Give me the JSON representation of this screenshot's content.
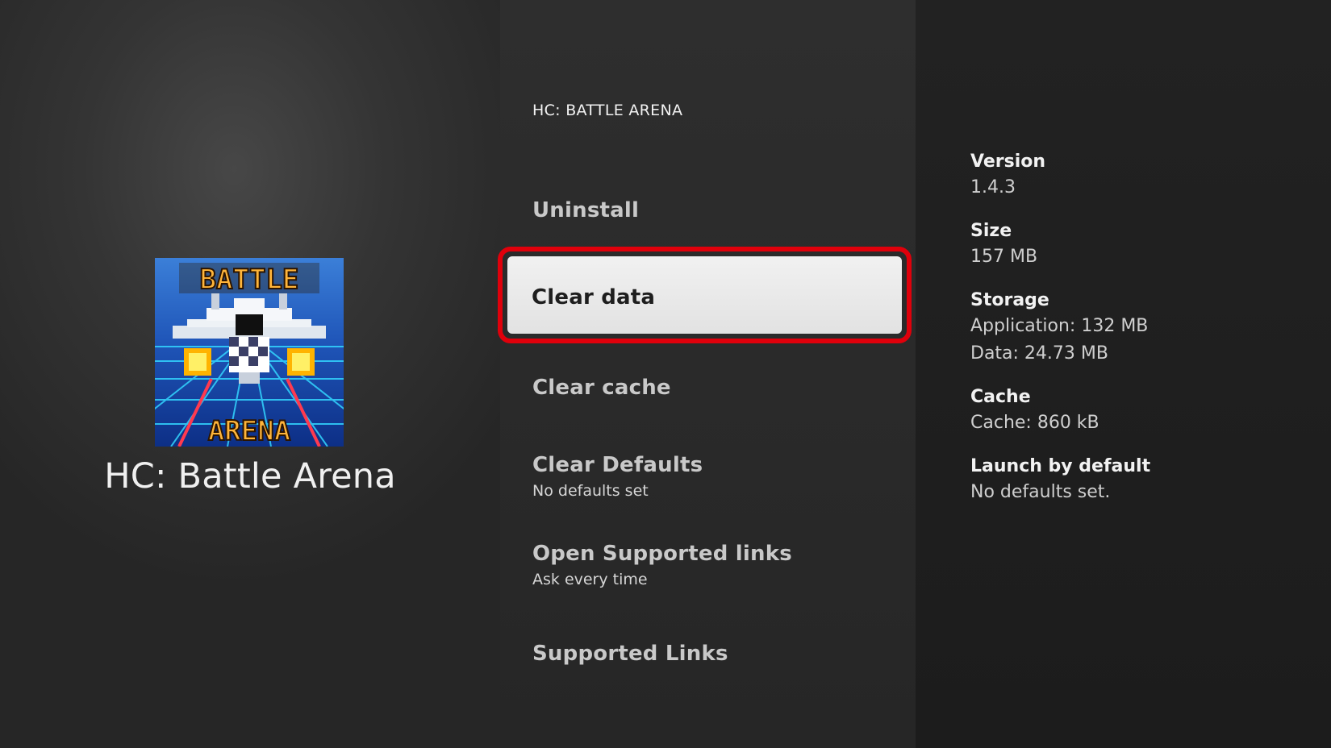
{
  "app": {
    "name": "HC: Battle Arena",
    "icon_text_top": "BATTLE",
    "icon_text_bottom": "ARENA"
  },
  "menu": {
    "header": "HC: BATTLE ARENA",
    "items": [
      {
        "label": "Uninstall",
        "sub": ""
      },
      {
        "label": "Clear data",
        "sub": "",
        "selected": true
      },
      {
        "label": "Clear cache",
        "sub": ""
      },
      {
        "label": "Clear Defaults",
        "sub": "No defaults set"
      },
      {
        "label": "Open Supported links",
        "sub": "Ask every time"
      },
      {
        "label": "Supported Links",
        "sub": ""
      }
    ]
  },
  "info": {
    "version": {
      "heading": "Version",
      "value": "1.4.3"
    },
    "size": {
      "heading": "Size",
      "value": "157 MB"
    },
    "storage": {
      "heading": "Storage",
      "application": "Application: 132 MB",
      "data": "Data: 24.73 MB"
    },
    "cache": {
      "heading": "Cache",
      "value": "Cache: 860 kB"
    },
    "launch": {
      "heading": "Launch by default",
      "value": "No defaults set."
    }
  },
  "colors": {
    "highlight_border": "#e0000b",
    "selected_background": "#eaeaea"
  }
}
